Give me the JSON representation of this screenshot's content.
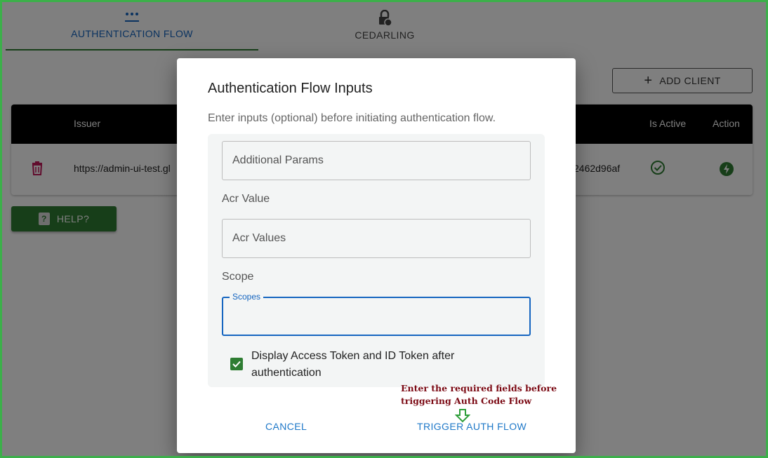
{
  "tabs": [
    {
      "label": "AUTHENTICATION FLOW",
      "icon": "dots-icon"
    },
    {
      "label": "CEDARLING",
      "icon": "lock-icon"
    }
  ],
  "toolbar": {
    "add_client_label": "ADD CLIENT"
  },
  "table": {
    "headers": {
      "issuer": "Issuer",
      "is_active": "Is Active",
      "action": "Action"
    },
    "row": {
      "issuer": "https://admin-ui-test.gl",
      "client_suffix": "2462d96af"
    }
  },
  "help": {
    "label": "HELP?",
    "icon_glyph": "?"
  },
  "dialog": {
    "title": "Authentication Flow Inputs",
    "subtitle": "Enter inputs (optional) before initiating authentication flow.",
    "additional_params_placeholder": "Additional Params",
    "acr_label": "Acr Value",
    "acr_placeholder": "Acr Values",
    "scope_label": "Scope",
    "scopes_legend": "Scopes",
    "checkbox_label": "Display Access Token and ID Token after authentication",
    "checkbox_checked": true,
    "annotation_line1": "Enter the required fields before",
    "annotation_line2": "triggering Auth Code Flow",
    "cancel_label": "CANCEL",
    "trigger_label": "TRIGGER AUTH FLOW"
  },
  "colors": {
    "primary_blue": "#1565c0",
    "green": "#2e7d32",
    "annotation_red": "#7b0a14"
  }
}
